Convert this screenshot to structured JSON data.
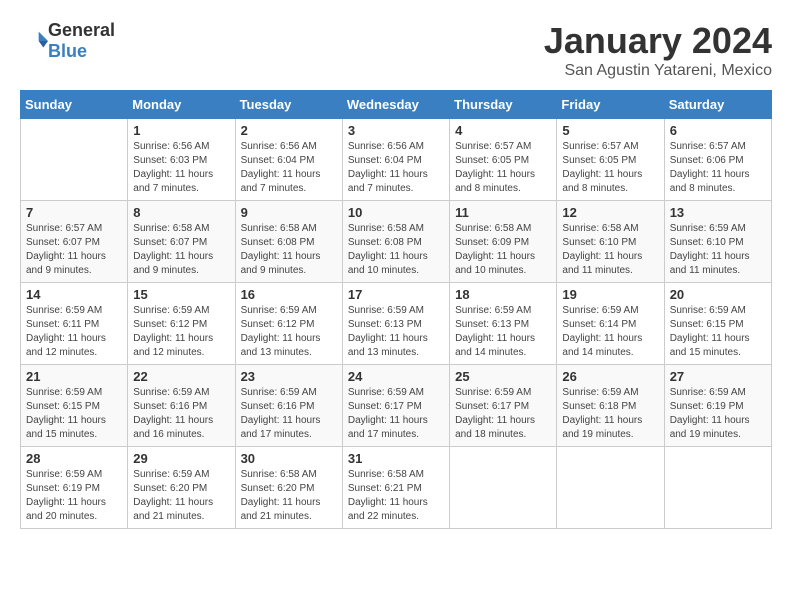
{
  "header": {
    "logo": {
      "general": "General",
      "blue": "Blue",
      "icon_color": "#3a7fc1"
    },
    "month": "January 2024",
    "location": "San Agustin Yatareni, Mexico"
  },
  "days_of_week": [
    "Sunday",
    "Monday",
    "Tuesday",
    "Wednesday",
    "Thursday",
    "Friday",
    "Saturday"
  ],
  "weeks": [
    [
      {
        "day": "",
        "info": ""
      },
      {
        "day": "1",
        "info": "Sunrise: 6:56 AM\nSunset: 6:03 PM\nDaylight: 11 hours\nand 7 minutes."
      },
      {
        "day": "2",
        "info": "Sunrise: 6:56 AM\nSunset: 6:04 PM\nDaylight: 11 hours\nand 7 minutes."
      },
      {
        "day": "3",
        "info": "Sunrise: 6:56 AM\nSunset: 6:04 PM\nDaylight: 11 hours\nand 7 minutes."
      },
      {
        "day": "4",
        "info": "Sunrise: 6:57 AM\nSunset: 6:05 PM\nDaylight: 11 hours\nand 8 minutes."
      },
      {
        "day": "5",
        "info": "Sunrise: 6:57 AM\nSunset: 6:05 PM\nDaylight: 11 hours\nand 8 minutes."
      },
      {
        "day": "6",
        "info": "Sunrise: 6:57 AM\nSunset: 6:06 PM\nDaylight: 11 hours\nand 8 minutes."
      }
    ],
    [
      {
        "day": "7",
        "info": "Sunrise: 6:57 AM\nSunset: 6:07 PM\nDaylight: 11 hours\nand 9 minutes."
      },
      {
        "day": "8",
        "info": "Sunrise: 6:58 AM\nSunset: 6:07 PM\nDaylight: 11 hours\nand 9 minutes."
      },
      {
        "day": "9",
        "info": "Sunrise: 6:58 AM\nSunset: 6:08 PM\nDaylight: 11 hours\nand 9 minutes."
      },
      {
        "day": "10",
        "info": "Sunrise: 6:58 AM\nSunset: 6:08 PM\nDaylight: 11 hours\nand 10 minutes."
      },
      {
        "day": "11",
        "info": "Sunrise: 6:58 AM\nSunset: 6:09 PM\nDaylight: 11 hours\nand 10 minutes."
      },
      {
        "day": "12",
        "info": "Sunrise: 6:58 AM\nSunset: 6:10 PM\nDaylight: 11 hours\nand 11 minutes."
      },
      {
        "day": "13",
        "info": "Sunrise: 6:59 AM\nSunset: 6:10 PM\nDaylight: 11 hours\nand 11 minutes."
      }
    ],
    [
      {
        "day": "14",
        "info": "Sunrise: 6:59 AM\nSunset: 6:11 PM\nDaylight: 11 hours\nand 12 minutes."
      },
      {
        "day": "15",
        "info": "Sunrise: 6:59 AM\nSunset: 6:12 PM\nDaylight: 11 hours\nand 12 minutes."
      },
      {
        "day": "16",
        "info": "Sunrise: 6:59 AM\nSunset: 6:12 PM\nDaylight: 11 hours\nand 13 minutes."
      },
      {
        "day": "17",
        "info": "Sunrise: 6:59 AM\nSunset: 6:13 PM\nDaylight: 11 hours\nand 13 minutes."
      },
      {
        "day": "18",
        "info": "Sunrise: 6:59 AM\nSunset: 6:13 PM\nDaylight: 11 hours\nand 14 minutes."
      },
      {
        "day": "19",
        "info": "Sunrise: 6:59 AM\nSunset: 6:14 PM\nDaylight: 11 hours\nand 14 minutes."
      },
      {
        "day": "20",
        "info": "Sunrise: 6:59 AM\nSunset: 6:15 PM\nDaylight: 11 hours\nand 15 minutes."
      }
    ],
    [
      {
        "day": "21",
        "info": "Sunrise: 6:59 AM\nSunset: 6:15 PM\nDaylight: 11 hours\nand 15 minutes."
      },
      {
        "day": "22",
        "info": "Sunrise: 6:59 AM\nSunset: 6:16 PM\nDaylight: 11 hours\nand 16 minutes."
      },
      {
        "day": "23",
        "info": "Sunrise: 6:59 AM\nSunset: 6:16 PM\nDaylight: 11 hours\nand 17 minutes."
      },
      {
        "day": "24",
        "info": "Sunrise: 6:59 AM\nSunset: 6:17 PM\nDaylight: 11 hours\nand 17 minutes."
      },
      {
        "day": "25",
        "info": "Sunrise: 6:59 AM\nSunset: 6:17 PM\nDaylight: 11 hours\nand 18 minutes."
      },
      {
        "day": "26",
        "info": "Sunrise: 6:59 AM\nSunset: 6:18 PM\nDaylight: 11 hours\nand 19 minutes."
      },
      {
        "day": "27",
        "info": "Sunrise: 6:59 AM\nSunset: 6:19 PM\nDaylight: 11 hours\nand 19 minutes."
      }
    ],
    [
      {
        "day": "28",
        "info": "Sunrise: 6:59 AM\nSunset: 6:19 PM\nDaylight: 11 hours\nand 20 minutes."
      },
      {
        "day": "29",
        "info": "Sunrise: 6:59 AM\nSunset: 6:20 PM\nDaylight: 11 hours\nand 21 minutes."
      },
      {
        "day": "30",
        "info": "Sunrise: 6:58 AM\nSunset: 6:20 PM\nDaylight: 11 hours\nand 21 minutes."
      },
      {
        "day": "31",
        "info": "Sunrise: 6:58 AM\nSunset: 6:21 PM\nDaylight: 11 hours\nand 22 minutes."
      },
      {
        "day": "",
        "info": ""
      },
      {
        "day": "",
        "info": ""
      },
      {
        "day": "",
        "info": ""
      }
    ]
  ]
}
